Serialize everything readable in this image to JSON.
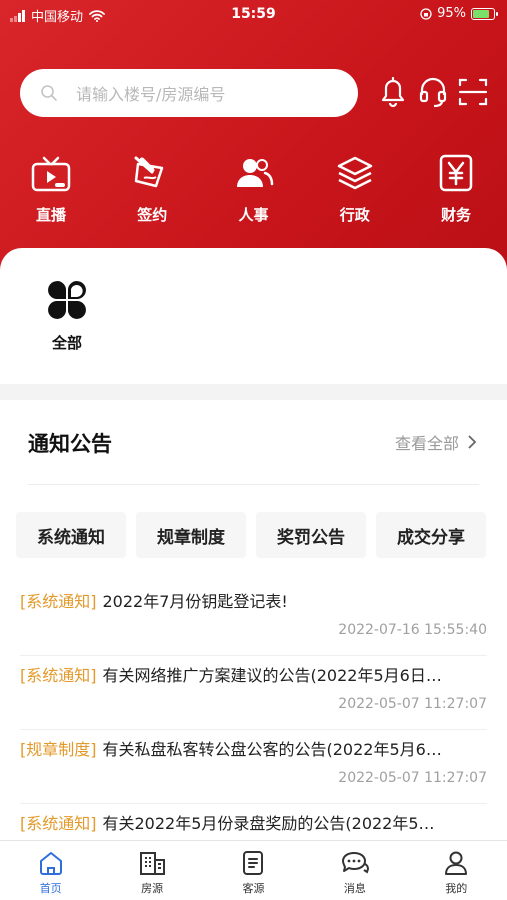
{
  "status_bar": {
    "carrier": "中国移动",
    "time": "15:59",
    "battery": "95%"
  },
  "search": {
    "placeholder": "请输入楼号/房源编号"
  },
  "header_icons": [
    "bell-icon",
    "headset-icon",
    "scan-icon"
  ],
  "categories": [
    {
      "label": "直播",
      "icon": "tv-icon"
    },
    {
      "label": "签约",
      "icon": "sign-icon"
    },
    {
      "label": "人事",
      "icon": "people-icon"
    },
    {
      "label": "行政",
      "icon": "layers-icon"
    },
    {
      "label": "财务",
      "icon": "yen-icon"
    }
  ],
  "all_apps": {
    "label": "全部",
    "icon": "grid-icon"
  },
  "notices": {
    "title": "通知公告",
    "view_all": "查看全部",
    "tabs": [
      "系统通知",
      "规章制度",
      "奖罚公告",
      "成交分享"
    ],
    "items": [
      {
        "tag": "[系统通知]",
        "title": "2022年7月份钥匙登记表!",
        "date": "2022-07-16 15:55:40"
      },
      {
        "tag": "[系统通知]",
        "title": "有关网络推广方案建议的公告(2022年5月6日…",
        "date": "2022-05-07 11:27:07"
      },
      {
        "tag": "[规章制度]",
        "title": "有关私盘私客转公盘公客的公告(2022年5月6…",
        "date": "2022-05-07 11:27:07"
      },
      {
        "tag": "[系统通知]",
        "title": "有关2022年5月份录盘奖励的公告(2022年5…",
        "date": ""
      }
    ]
  },
  "tabbar": [
    {
      "label": "首页",
      "icon": "home-icon",
      "active": true
    },
    {
      "label": "房源",
      "icon": "building-icon",
      "active": false
    },
    {
      "label": "客源",
      "icon": "document-icon",
      "active": false
    },
    {
      "label": "消息",
      "icon": "chat-icon",
      "active": false
    },
    {
      "label": "我的",
      "icon": "user-icon",
      "active": false
    }
  ],
  "colors": {
    "brand_red": "#d3201f",
    "tag_orange": "#e39a2a",
    "active_blue": "#2f6fdc"
  }
}
